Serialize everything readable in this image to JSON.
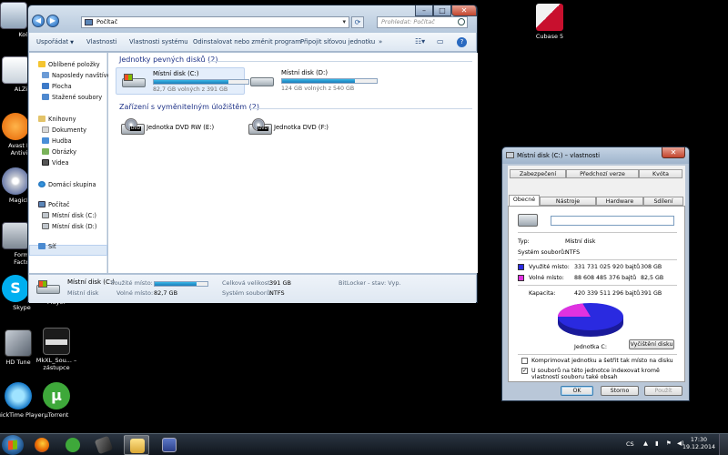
{
  "desktop": {
    "icons": [
      {
        "label": "Koš"
      },
      {
        "label": "ALZip"
      },
      {
        "label": "Avast Free Antivirus"
      },
      {
        "label": "MagicISO"
      },
      {
        "label": "Format Factory"
      },
      {
        "label": "Skype"
      },
      {
        "label": "Player"
      },
      {
        "label": "HD Tune"
      },
      {
        "label": "MkXL_Sou... – zástupce"
      },
      {
        "label": "QuickTime Player"
      },
      {
        "label": "µTorrent"
      },
      {
        "label": "Cubase 5"
      }
    ]
  },
  "explorer": {
    "address": {
      "path": "Počítač"
    },
    "search": {
      "placeholder": "Prohledat: Počítač"
    },
    "toolbar": {
      "organize": "Uspořádat",
      "properties": "Vlastnosti",
      "system_properties": "Vlastnosti systému",
      "uninstall": "Odinstalovat nebo změnit program",
      "map_drive": "Připojit síťovou jednotku",
      "more": "»"
    },
    "nav": {
      "favorites": "Oblíbené položky",
      "recent": "Naposledy navštívené",
      "desktop": "Plocha",
      "downloads": "Stažené soubory",
      "libraries": "Knihovny",
      "documents": "Dokumenty",
      "music": "Hudba",
      "pictures": "Obrázky",
      "videos": "Videa",
      "homegroup": "Domácí skupina",
      "computer": "Počítač",
      "disk_c": "Místní disk (C:)",
      "disk_d": "Místní disk (D:)",
      "network": "Síť"
    },
    "groups": {
      "hard_disks": "Jednotky pevných disků (2)",
      "removable": "Zařízení s vyměnitelným úložištěm (2)"
    },
    "drives": [
      {
        "name": "Místní disk (C:)",
        "free": "82,7 GB volných z 391 GB",
        "used_fraction": 0.79
      },
      {
        "name": "Místní disk (D:)",
        "free": "124 GB volných z 540 GB",
        "used_fraction": 0.77
      }
    ],
    "removable": [
      {
        "name": "Jednotka DVD RW (E:)"
      },
      {
        "name": "Jednotka DVD (F:)"
      }
    ],
    "details": {
      "name": "Místní disk (C:)",
      "type": "Místní disk",
      "used_label": "Použité místo:",
      "used_fraction": 0.79,
      "free_label": "Volné místo:",
      "free_value": "82,7 GB",
      "total_label": "Celková velikost:",
      "total_value": "391 GB",
      "fs_label": "Systém souborů:",
      "fs_value": "NTFS",
      "bitlocker": "BitLocker - stav: Vyp."
    }
  },
  "props": {
    "title": "Místní disk (C:) – vlastnosti",
    "tabs": {
      "security": "Zabezpečení",
      "previous": "Předchozí verze",
      "quota": "Kvóta",
      "general": "Obecné",
      "tools": "Nástroje",
      "hardware": "Hardware",
      "sharing": "Sdílení"
    },
    "label_value": "",
    "type_label": "Typ:",
    "type_value": "Místní disk",
    "fs_label": "Systém souborů:",
    "fs_value": "NTFS",
    "used_label": "Využité místo:",
    "used_bytes": "331 731 025 920 bajtů",
    "used_gb": "308 GB",
    "free_label": "Volné místo:",
    "free_bytes": "88 608 485 376 bajtů",
    "free_gb": "82,5 GB",
    "capacity_label": "Kapacita:",
    "capacity_bytes": "420 339 511 296 bajtů",
    "capacity_gb": "391 GB",
    "drive_label": "Jednotka C:",
    "cleanup_button": "Vyčištění disku",
    "compress_check": "Komprimovat jednotku a šetřit tak místo na disku",
    "index_check": "U souborů na této jednotce indexovat kromě vlastností souboru také obsah",
    "ok": "OK",
    "cancel": "Storno",
    "apply": "Použít",
    "colors": {
      "used": "#2a2ae0",
      "free": "#e032e0"
    },
    "used_fraction": 0.789
  },
  "taskbar": {
    "language": "CS",
    "time": "17:30",
    "date": "19.12.2014"
  }
}
